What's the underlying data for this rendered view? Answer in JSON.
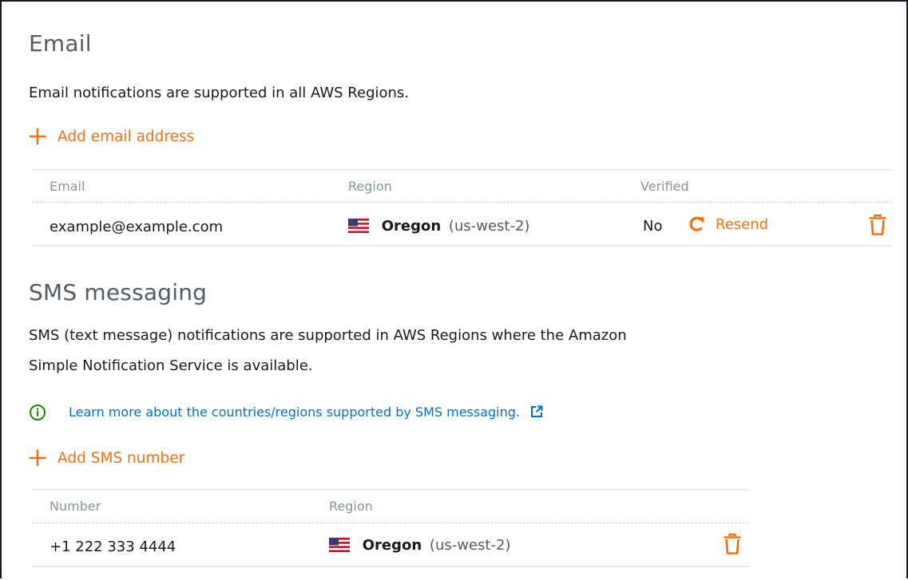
{
  "email_section": {
    "title": "Email",
    "description": "Email notifications are supported in all AWS Regions.",
    "add_label": "Add email address",
    "columns": [
      "Email",
      "Region",
      "Verified"
    ],
    "rows": [
      {
        "email": "example@example.com",
        "region_name": "Oregon",
        "region_code": "(us-west-2)",
        "verified": "No",
        "resend_label": "Resend"
      }
    ]
  },
  "sms_section": {
    "title": "SMS messaging",
    "description_line1": "SMS (text message) notifications are supported in AWS Regions where the Amazon",
    "description_line2": "Simple Notification Service is available.",
    "info_link": "Learn more about the countries/regions supported by SMS messaging.",
    "add_label": "Add SMS number",
    "columns": [
      "Number",
      "Region"
    ],
    "rows": [
      {
        "number": "+1 222 333 4444",
        "region_name": "Oregon",
        "region_code": "(us-west-2)"
      }
    ]
  },
  "icons": {
    "add": "plus-icon",
    "delete": "trash-icon",
    "resend": "refresh-icon",
    "info": "info-circle-icon",
    "external": "external-link-icon",
    "flag": "us-flag-icon"
  },
  "colors": {
    "accent": "#ec7211",
    "link": "#0073bb",
    "info": "#1d8102",
    "muted": "#879596"
  }
}
